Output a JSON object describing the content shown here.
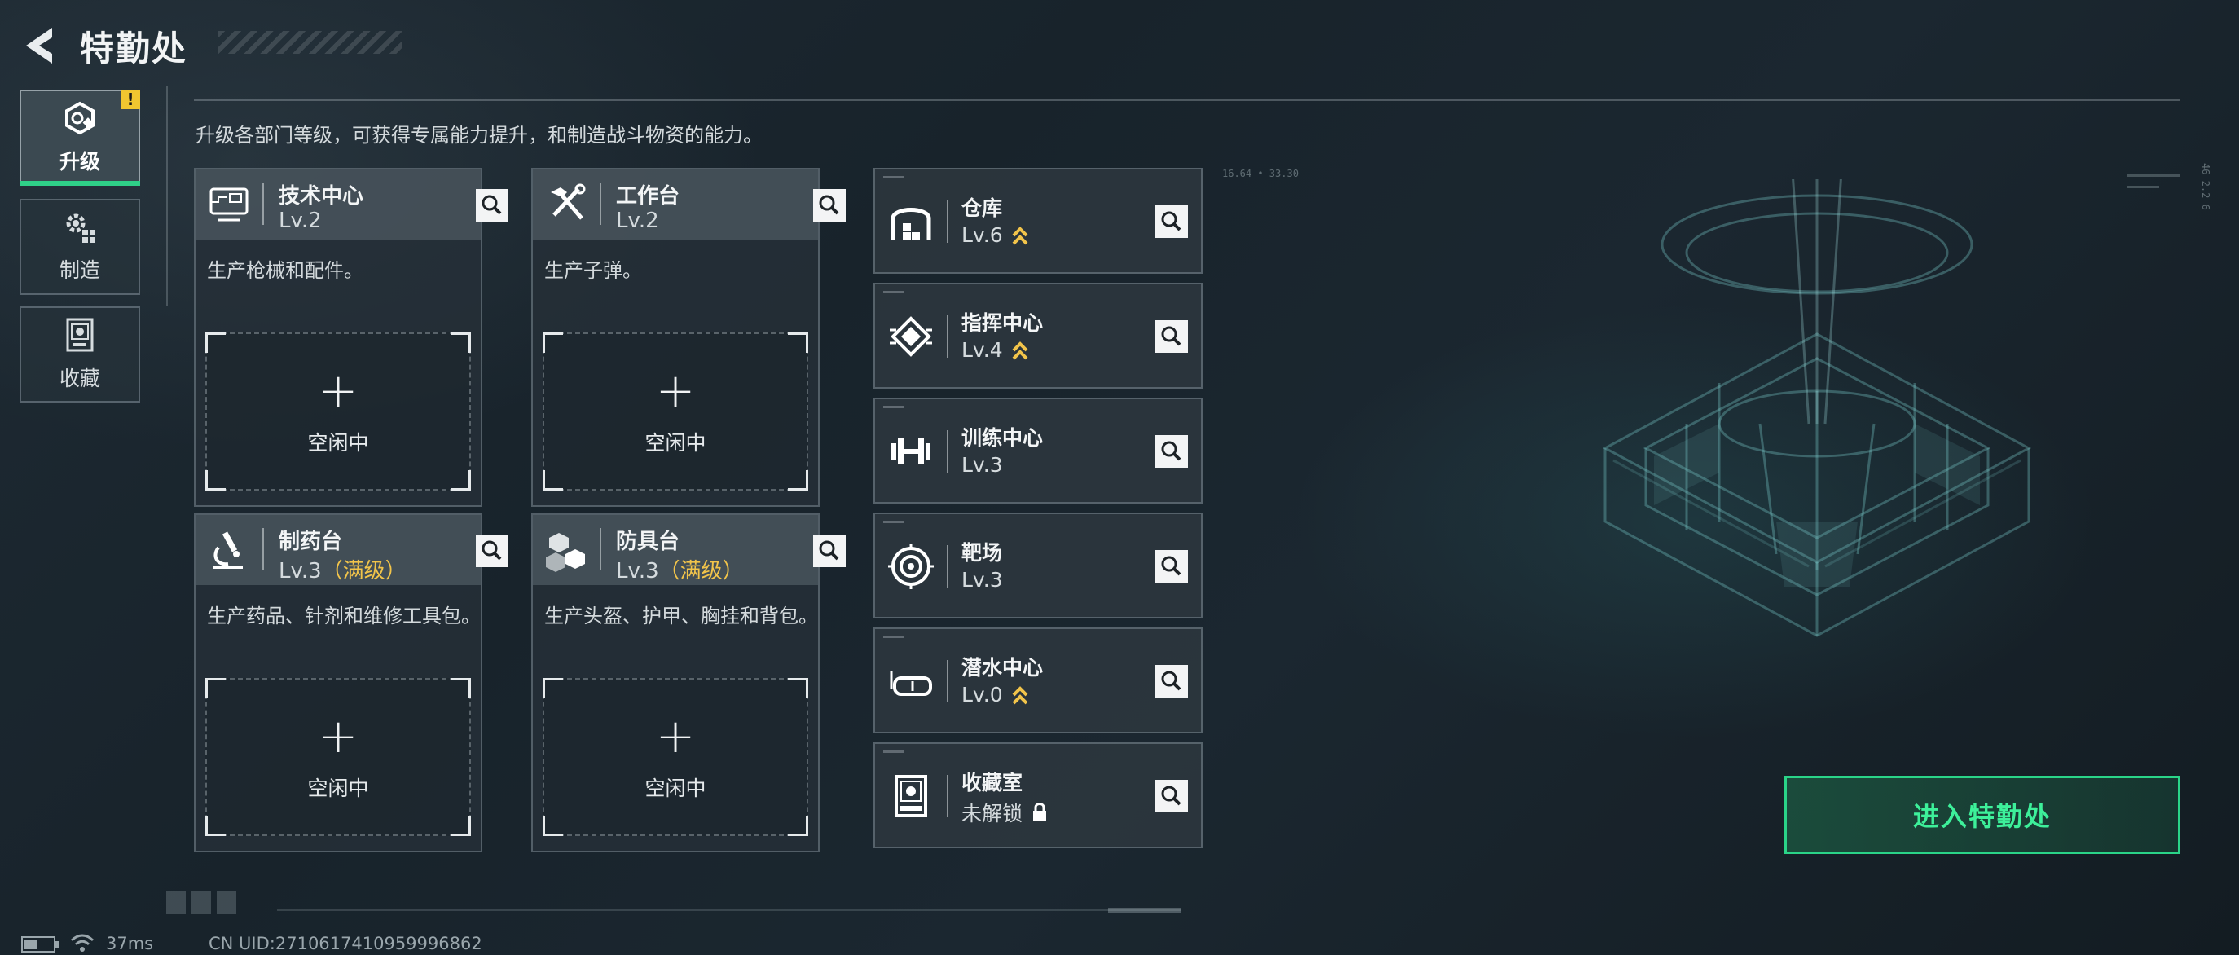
{
  "header": {
    "title": "特勤处"
  },
  "nav": [
    {
      "label": "升级",
      "icon": "upgrade-icon",
      "active": true,
      "badge": "!"
    },
    {
      "label": "制造",
      "icon": "gears-icon",
      "active": false
    },
    {
      "label": "收藏",
      "icon": "collection-icon",
      "active": false
    }
  ],
  "subtitle": "升级各部门等级，可获得专属能力提升，和制造战斗物资的能力。",
  "departments": [
    {
      "name": "技术中心",
      "level": "Lv.2",
      "max": "",
      "desc": "生产枪械和配件。",
      "icon": "monitor-icon",
      "slot": {
        "plus": "+",
        "status": "空闲中"
      }
    },
    {
      "name": "工作台",
      "level": "Lv.2",
      "max": "",
      "desc": "生产子弹。",
      "icon": "tools-icon",
      "slot": {
        "plus": "+",
        "status": "空闲中"
      }
    },
    {
      "name": "制药台",
      "level": "Lv.3",
      "max": "（满级）",
      "desc": "生产药品、针剂和维修工具包。",
      "icon": "microscope-icon",
      "slot": {
        "plus": "+",
        "status": "空闲中"
      }
    },
    {
      "name": "防具台",
      "level": "Lv.3",
      "max": "（满级）",
      "desc": "生产头盔、护甲、胸挂和背包。",
      "icon": "armor-boxes-icon",
      "slot": {
        "plus": "+",
        "status": "空闲中"
      }
    }
  ],
  "facilities": [
    {
      "name": "仓库",
      "level": "Lv.6",
      "upgradable": true,
      "icon": "warehouse-icon"
    },
    {
      "name": "指挥中心",
      "level": "Lv.4",
      "upgradable": true,
      "icon": "chip-icon"
    },
    {
      "name": "训练中心",
      "level": "Lv.3",
      "upgradable": false,
      "icon": "dumbbell-icon"
    },
    {
      "name": "靶场",
      "level": "Lv.3",
      "upgradable": false,
      "icon": "target-icon"
    },
    {
      "name": "潜水中心",
      "level": "Lv.0",
      "upgradable": true,
      "icon": "diving-mask-icon"
    },
    {
      "name": "收藏室",
      "level": "未解锁",
      "upgradable": false,
      "locked": true,
      "icon": "display-case-icon"
    }
  ],
  "enter_button": "进入特勤处",
  "status_bar": {
    "ping": "37ms",
    "uid": "CN UID:2710617410959996862"
  },
  "deco": {
    "top_code": "16.64 • 33.30",
    "side_code": "46 2.2 6"
  },
  "colors": {
    "accent_green": "#2ad488",
    "max_gold": "#f2c44a",
    "badge_yellow": "#f0c630"
  }
}
